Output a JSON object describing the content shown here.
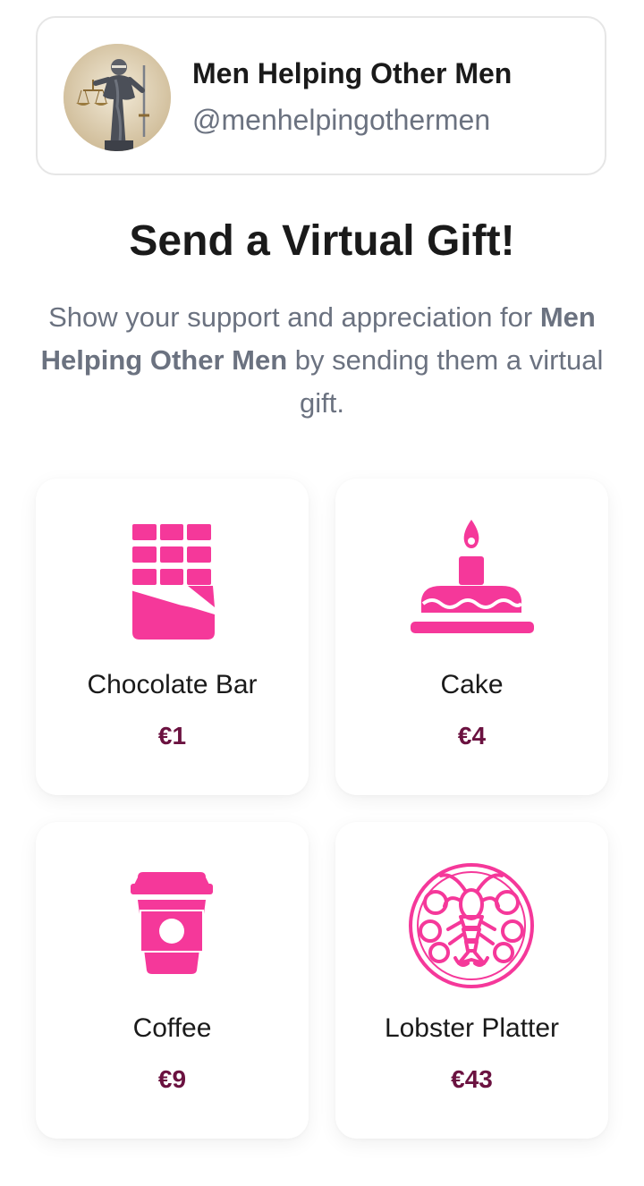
{
  "profile": {
    "name": "Men Helping Other Men",
    "handle": "@menhelpingothermen",
    "avatar_icon": "lady-justice-statue"
  },
  "heading": "Send a Virtual Gift!",
  "intro": {
    "before": "Show your support and appreciation for ",
    "name": "Men Helping Other Men",
    "after": " by sending them a virtual gift."
  },
  "accent_color": "#f5389a",
  "price_color": "#6b1240",
  "gifts": [
    {
      "name": "Chocolate Bar",
      "price": "€1",
      "icon": "chocolate-bar-icon"
    },
    {
      "name": "Cake",
      "price": "€4",
      "icon": "cake-icon"
    },
    {
      "name": "Coffee",
      "price": "€9",
      "icon": "coffee-cup-icon"
    },
    {
      "name": "Lobster Platter",
      "price": "€43",
      "icon": "lobster-platter-icon"
    }
  ]
}
